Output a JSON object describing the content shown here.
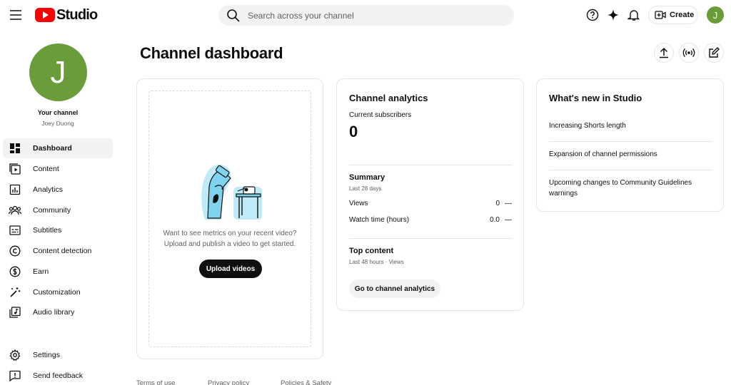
{
  "header": {
    "logo_text": "Studio",
    "search_placeholder": "Search across your channel",
    "create_label": "Create",
    "avatar_letter": "J",
    "icons": [
      "menu-icon",
      "search-icon",
      "help-icon",
      "sparkle-icon",
      "bell-icon",
      "create-video-icon"
    ]
  },
  "sidebar": {
    "avatar_letter": "J",
    "your_channel": "Your channel",
    "channel_name": "Joey Duong",
    "items": [
      {
        "label": "Dashboard",
        "icon": "dashboard-icon"
      },
      {
        "label": "Content",
        "icon": "content-icon"
      },
      {
        "label": "Analytics",
        "icon": "analytics-icon"
      },
      {
        "label": "Community",
        "icon": "community-icon"
      },
      {
        "label": "Subtitles",
        "icon": "subtitles-icon"
      },
      {
        "label": "Content detection",
        "icon": "copyright-icon"
      },
      {
        "label": "Earn",
        "icon": "dollar-icon"
      },
      {
        "label": "Customization",
        "icon": "magic-wand-icon"
      },
      {
        "label": "Audio library",
        "icon": "audio-library-icon"
      }
    ],
    "bottom_items": [
      {
        "label": "Settings",
        "icon": "gear-icon"
      },
      {
        "label": "Send feedback",
        "icon": "feedback-icon"
      }
    ]
  },
  "main": {
    "title": "Channel dashboard",
    "upload_card": {
      "text_line1": "Want to see metrics on your recent video?",
      "text_line2": "Upload and publish a video to get started.",
      "button": "Upload videos"
    },
    "analytics_card": {
      "title": "Channel analytics",
      "subscribers_label": "Current subscribers",
      "subscribers_value": "0",
      "summary_title": "Summary",
      "summary_period": "Last 28 days",
      "metrics": [
        {
          "label": "Views",
          "value": "0",
          "trend": "—"
        },
        {
          "label": "Watch time (hours)",
          "value": "0.0",
          "trend": "—"
        }
      ],
      "top_content_title": "Top content",
      "top_content_period": "Last 48 hours · Views",
      "button": "Go to channel analytics"
    },
    "news_card": {
      "title": "What's new in Studio",
      "items": [
        "Increasing Shorts length",
        "Expansion of channel permissions",
        "Upcoming changes to Community Guidelines warnings"
      ]
    }
  },
  "footer": {
    "links": [
      "Terms of use",
      "Privacy policy",
      "Policies & Safety"
    ]
  },
  "colors": {
    "brand_red": "#ff0000",
    "avatar_green": "#6a9c3a",
    "illustration_blue": "#7fd3ef"
  }
}
